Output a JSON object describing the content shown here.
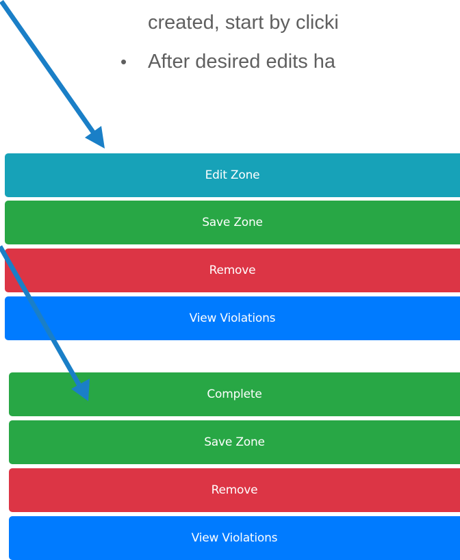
{
  "slide": {
    "line1": "created, start by clicki",
    "bullet_char": "•",
    "line2": "After desired edits ha"
  },
  "panel_view": {
    "edit_label": "Edit Zone",
    "save_label": "Save Zone",
    "remove_label": "Remove",
    "violations_label": "View Violations"
  },
  "panel_edit": {
    "complete_label": "Complete",
    "save_label": "Save Zone",
    "remove_label": "Remove",
    "violations_label": "View Violations"
  },
  "colors": {
    "info": "#17a2b8",
    "success": "#28a745",
    "danger": "#dc3545",
    "primary": "#007bff",
    "arrow": "#1a7fc7",
    "text": "#5f5f5f"
  }
}
